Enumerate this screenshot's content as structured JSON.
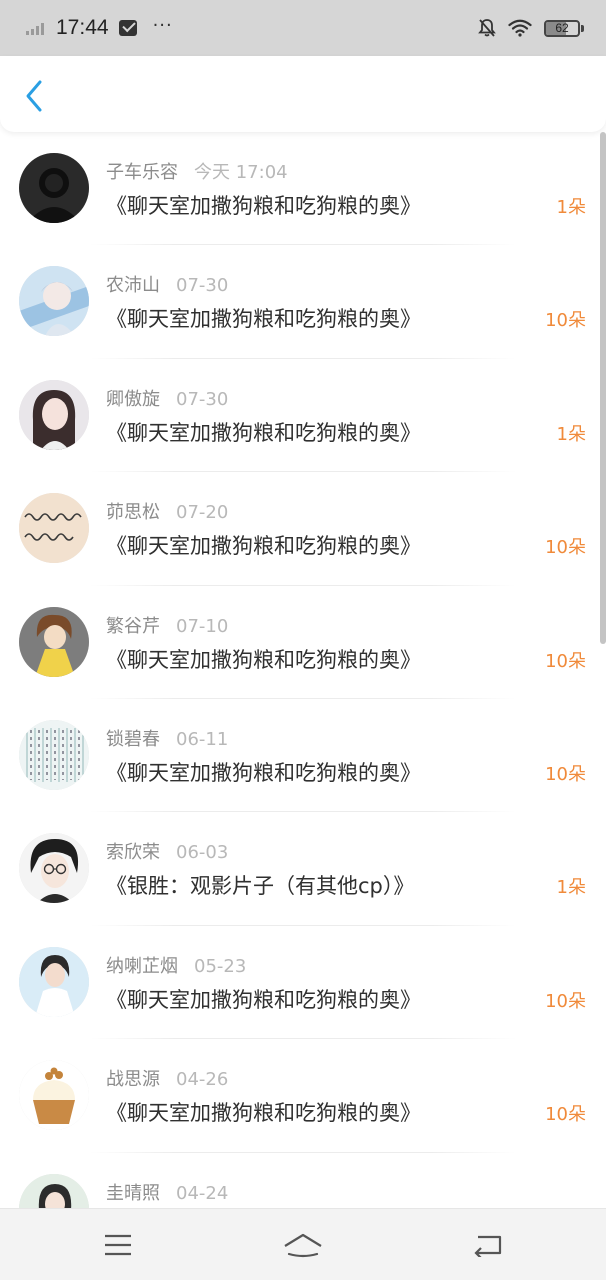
{
  "status_bar": {
    "time": "17:44",
    "battery": "62",
    "battery_level": 0.62,
    "icons": [
      "signal-icon",
      "message-icon",
      "more-dots-icon",
      "mute-bell-icon",
      "wifi-icon",
      "battery-icon"
    ]
  },
  "header": {
    "back_icon": "chevron-left-icon",
    "accent_color": "#2a9fe3"
  },
  "list": {
    "count_color": "#f08a3a",
    "items": [
      {
        "name": "子车乐容",
        "date": "今天 17:04",
        "title": "《聊天室加撒狗粮和吃狗粮的奥》",
        "count": "1朵",
        "avatar": "dark-silhouette"
      },
      {
        "name": "农沛山",
        "date": "07-30",
        "title": "《聊天室加撒狗粮和吃狗粮的奥》",
        "count": "10朵",
        "avatar": "anime-blue"
      },
      {
        "name": "卿傲旋",
        "date": "07-30",
        "title": "《聊天室加撒狗粮和吃狗粮的奥》",
        "count": "1朵",
        "avatar": "girl-portrait"
      },
      {
        "name": "茆思松",
        "date": "07-20",
        "title": "《聊天室加撒狗粮和吃狗粮的奥》",
        "count": "10朵",
        "avatar": "handwriting"
      },
      {
        "name": "繁谷芹",
        "date": "07-10",
        "title": "《聊天室加撒狗粮和吃狗粮的奥》",
        "count": "10朵",
        "avatar": "cartoon-girl"
      },
      {
        "name": "锁碧春",
        "date": "06-11",
        "title": "《聊天室加撒狗粮和吃狗粮的奥》",
        "count": "10朵",
        "avatar": "text-pattern"
      },
      {
        "name": "索欣荣",
        "date": "06-03",
        "title": "《银胜：观影片子（有其他cp）》",
        "count": "1朵",
        "avatar": "anime-glasses"
      },
      {
        "name": "纳喇芷烟",
        "date": "05-23",
        "title": "《聊天室加撒狗粮和吃狗粮的奥》",
        "count": "10朵",
        "avatar": "woman-white"
      },
      {
        "name": "战思源",
        "date": "04-26",
        "title": "《聊天室加撒狗粮和吃狗粮的奥》",
        "count": "10朵",
        "avatar": "cupcake"
      },
      {
        "name": "圭晴照",
        "date": "04-24",
        "title": "",
        "count": "",
        "avatar": "girl-partial"
      }
    ]
  },
  "nav_bar": {
    "icons": [
      "menu-icon",
      "home-icon",
      "back-icon"
    ]
  }
}
